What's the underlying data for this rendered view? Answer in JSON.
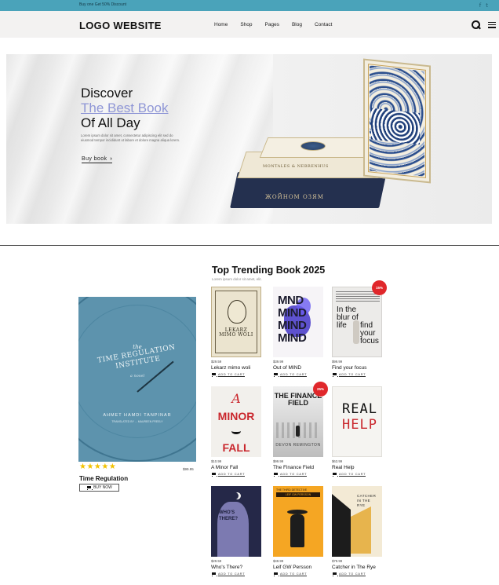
{
  "topbar": {
    "promo": "Buy one Get 50% Discount",
    "social": [
      "f",
      "t"
    ]
  },
  "header": {
    "logo": "LOGO WEBSITE",
    "nav": [
      "Home",
      "Shop",
      "Pages",
      "Blog",
      "Contact"
    ],
    "icons": [
      "search-icon",
      "menu-icon"
    ]
  },
  "hero": {
    "line1": "Discover",
    "line2": "The Best Book",
    "line3": "Of All Day",
    "description": "Lorem ipsum dolor sit amet, consectetur adipiscing elit sed do eiusmod tempor incididunt ut labore et dolore magna aliqua lorem.",
    "button": "Buy book",
    "button_icon": "chevron-right-icon",
    "book_titles": [
      "MONTALES & NEBRENHUS",
      "ЖОЙНОМ ОЗЯМ"
    ],
    "accent_color": "#8f96d6"
  },
  "featured": {
    "cover_small": "the",
    "cover_title": "TIME REGULATION INSTITUTE",
    "cover_subtitle": "a novel",
    "cover_author": "AHMET HAMDI TANPINAR",
    "cover_translator": "TRANSLATED BY ... MAUREEN FREELY",
    "rating": "★★★★★",
    "price": "$99.95",
    "title": "Time Regulation",
    "button": "BUY NOW"
  },
  "trending": {
    "title": "Top Trending Book 2025",
    "subtitle": "Lorem ipsum dolor sit amet, elit.",
    "add_label": "ADD TO CART",
    "books": [
      {
        "title": "Lekarz mimo woli",
        "price": "$29.59",
        "cover": [
          "LEKARZ",
          "MIMO WOLI"
        ]
      },
      {
        "title": "Out of MIND",
        "price": "$39.99",
        "cover": [
          "MND",
          "MIND",
          "MIND",
          "MIND"
        ]
      },
      {
        "title": "Find your focus",
        "price": "$99.99",
        "cover": [
          "In the blur of life",
          "find your focus"
        ],
        "badge": "15%"
      },
      {
        "title": "A Minor Fall",
        "price": "$10.99",
        "cover": [
          "A",
          "MINOR",
          "FALL"
        ]
      },
      {
        "title": "The Finance Field",
        "price": "$99.99",
        "cover": [
          "THE FINANCE FIELD",
          "DEVON REMINGTON"
        ],
        "badge": "25%"
      },
      {
        "title": "Real Help",
        "price": "$63.99",
        "cover": [
          "REAL",
          "HELP"
        ]
      },
      {
        "title": "Who's There?",
        "price": "$29.59",
        "cover": [
          "WHO'S",
          "THERE?"
        ]
      },
      {
        "title": "Leif GW Persson",
        "price": "$49.99",
        "cover": [
          "THE THIRD DETECTIVE",
          "LEIF GW PERSSON"
        ]
      },
      {
        "title": "Catcher in The Rye",
        "price": "$79.99",
        "cover": [
          "CATCHER",
          "IN THE",
          "RYE"
        ]
      }
    ]
  }
}
